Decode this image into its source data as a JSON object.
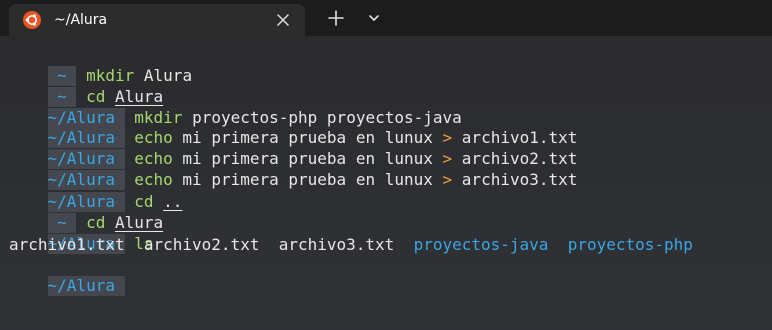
{
  "window": {
    "tab_title": "~/Alura",
    "icons": {
      "tab_icon": "ubuntu-logo-icon",
      "close": "close-icon",
      "new_tab": "plus-icon",
      "dropdown": "chevron-down-icon"
    }
  },
  "colors": {
    "prompt": "#3aa6e6",
    "prompt_bg": "#44474d",
    "command": "#a6d86e",
    "redirect": "#f0a040",
    "directory": "#3aa6e6",
    "text": "#e8e8e8",
    "ubuntu": "#e95420"
  },
  "terminal": {
    "lines": [
      {
        "prompt": "~",
        "cmd": "mkdir",
        "args": "Alura"
      },
      {
        "prompt": "~",
        "cmd": "cd",
        "args": "Alura"
      },
      {
        "prompt": "~/Alura",
        "cmd": "mkdir",
        "args": "proyectos-php proyectos-java"
      },
      {
        "prompt": "~/Alura",
        "cmd": "echo",
        "args": "mi primera prueba en lunux",
        "redir": ">",
        "target": "archivo1.txt"
      },
      {
        "prompt": "~/Alura",
        "cmd": "echo",
        "args": "mi primera prueba en lunux",
        "redir": ">",
        "target": "archivo2.txt"
      },
      {
        "prompt": "~/Alura",
        "cmd": "echo",
        "args": "mi primera prueba en lunux",
        "redir": ">",
        "target": "archivo3.txt"
      },
      {
        "prompt": "~/Alura",
        "cmd": "cd",
        "args": ".."
      },
      {
        "prompt": "~",
        "cmd": "cd",
        "args": "Alura"
      },
      {
        "prompt": "~/Alura",
        "cmd": "ls"
      }
    ],
    "ls_output": {
      "files": [
        "archivo1.txt",
        "archivo2.txt",
        "archivo3.txt"
      ],
      "dirs": [
        "proyectos-java",
        "proyectos-php"
      ]
    },
    "current_prompt": "~/Alura"
  }
}
